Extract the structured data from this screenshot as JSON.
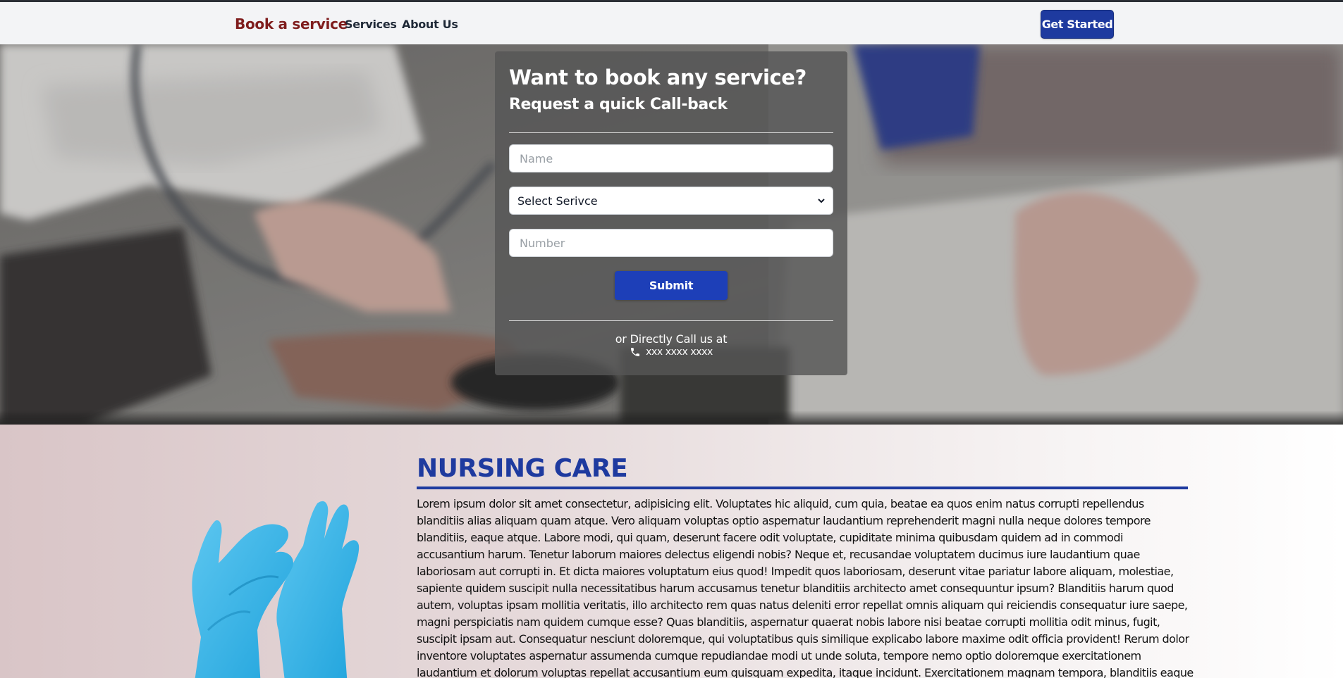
{
  "nav": {
    "brand": "Book a service",
    "links": [
      "Services",
      "About Us"
    ],
    "cta": "Get Started",
    "brand_color": "#7f1d1d",
    "accent_color": "#1e3a9f"
  },
  "hero": {
    "title": "Want to book any service?",
    "subtitle": "Request a quick Call-back",
    "name_placeholder": "Name",
    "service_select": {
      "selected": "Select Serivce"
    },
    "number_placeholder": "Number",
    "submit_label": "Submit",
    "call_text": "or Directly Call us at",
    "phone": "xxx xxxx xxxx",
    "phone_icon": "phone-icon"
  },
  "section": {
    "title": "NURSING CARE",
    "body": "Lorem ipsum dolor sit amet consectetur, adipisicing elit. Voluptates hic aliquid, cum quia, beatae ea quos enim natus corrupti repellendus blanditiis alias aliquam quam atque. Vero aliquam voluptas optio aspernatur laudantium reprehenderit magni nulla neque dolores tempore blanditiis, eaque atque. Labore modi, qui quam, deserunt facere odit voluptate, cupiditate minima quibusdam quidem ad in commodi accusantium harum. Tenetur laborum maiores delectus eligendi nobis? Neque et, recusandae voluptatem ducimus iure laudantium quae laboriosam aut corrupti in. Et dicta maiores voluptatum eius quod! Impedit quos laboriosam, deserunt vitae pariatur labore aliquam, molestiae, sapiente quidem suscipit nulla necessitatibus harum accusamus tenetur blanditiis architecto amet consequuntur ipsum? Blanditiis harum quod autem, voluptas ipsam mollitia veritatis, illo architecto rem quas natus deleniti error repellat omnis aliquam qui reiciendis consequatur iure saepe, magni perspiciatis nam quidem cumque esse? Quas blanditiis, aspernatur quaerat nobis labore nisi beatae corrupti mollitia odit minus, fugit, suscipit ipsam aut. Consequatur nesciunt doloremque, qui voluptatibus quis similique explicabo labore maxime odit officia provident! Rerum dolor inventore voluptates aspernatur assumenda cumque repudiandae modi ut unde soluta, tempore nemo optio doloremque exercitationem laudantium et dolorum voluptas repellat accusantium eum quisquam expedita, itaque incidunt. Exercitationem magnam tempora, blanditiis eaque saepe odio, iure laborum excepturi facere et accusantium."
  }
}
